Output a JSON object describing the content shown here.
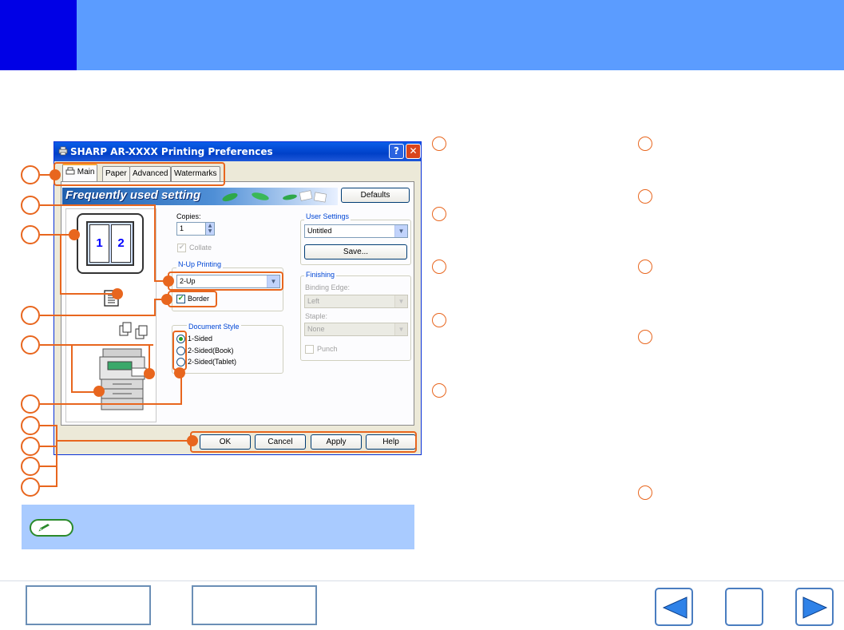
{
  "dialog": {
    "title": "SHARP AR-XXXX Printing Preferences",
    "title_buttons": {
      "help": "?",
      "close": "✕"
    },
    "tabs": [
      {
        "label": "Main",
        "active": true
      },
      {
        "label": "Paper",
        "active": false
      },
      {
        "label": "Advanced",
        "active": false
      },
      {
        "label": "Watermarks",
        "active": false
      }
    ],
    "banner": "Frequently used setting",
    "defaults_button": "Defaults",
    "copies": {
      "label": "Copies:",
      "value": "1",
      "collate_label": "Collate",
      "collate_checked": true
    },
    "nup": {
      "group_label": "N-Up Printing",
      "selected": "2-Up",
      "border_label": "Border",
      "border_checked": true
    },
    "preview": {
      "page1": "1",
      "page2": "2"
    },
    "document_style": {
      "group_label": "Document Style",
      "options": [
        "1-Sided",
        "2-Sided(Book)",
        "2-Sided(Tablet)"
      ],
      "selected_index": 0
    },
    "user_settings": {
      "group_label": "User Settings",
      "selected": "Untitled",
      "save_button": "Save..."
    },
    "finishing": {
      "group_label": "Finishing",
      "binding_edge_label": "Binding Edge:",
      "binding_edge_value": "Left",
      "staple_label": "Staple:",
      "staple_value": "None",
      "punch_label": "Punch"
    },
    "bottom_buttons": {
      "ok": "OK",
      "cancel": "Cancel",
      "apply": "Apply",
      "help": "Help"
    }
  },
  "colors": {
    "header_bar": "#5b9cff",
    "header_square": "#0000e6",
    "callout": "#e8661e",
    "note_bar": "#a9cbff"
  },
  "icons": {
    "printer": "printer-icon",
    "note": "pencil-icon",
    "nav_back": "arrow-left-icon",
    "nav_forward": "arrow-right-icon"
  }
}
